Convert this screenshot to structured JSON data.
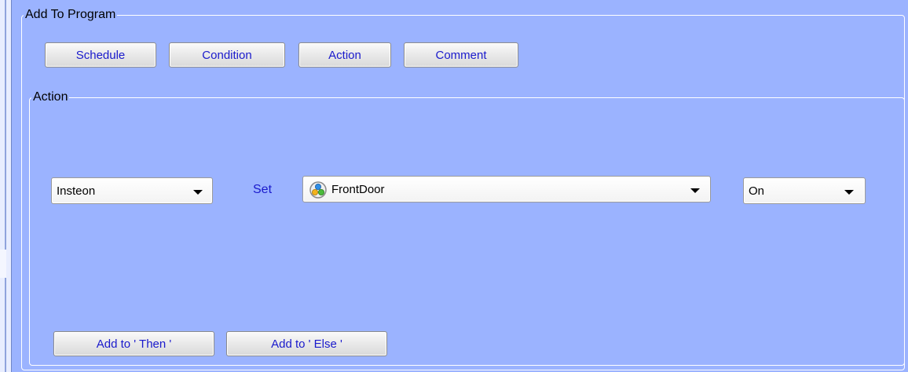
{
  "add_to_program": {
    "legend": "Add To Program",
    "buttons": {
      "schedule": "Schedule",
      "condition": "Condition",
      "action": "Action",
      "comment": "Comment"
    }
  },
  "action_panel": {
    "legend": "Action",
    "type_select": {
      "value": "Insteon"
    },
    "set_label": "Set",
    "device_select": {
      "value": "FrontDoor",
      "icon": "insteon-device-icon"
    },
    "state_select": {
      "value": "On"
    },
    "add_then": "Add to ' Then '",
    "add_else": "Add to ' Else '"
  },
  "colors": {
    "background": "#9bb3ff",
    "button_text": "#1a1acc",
    "label_text": "#1a1acc"
  }
}
